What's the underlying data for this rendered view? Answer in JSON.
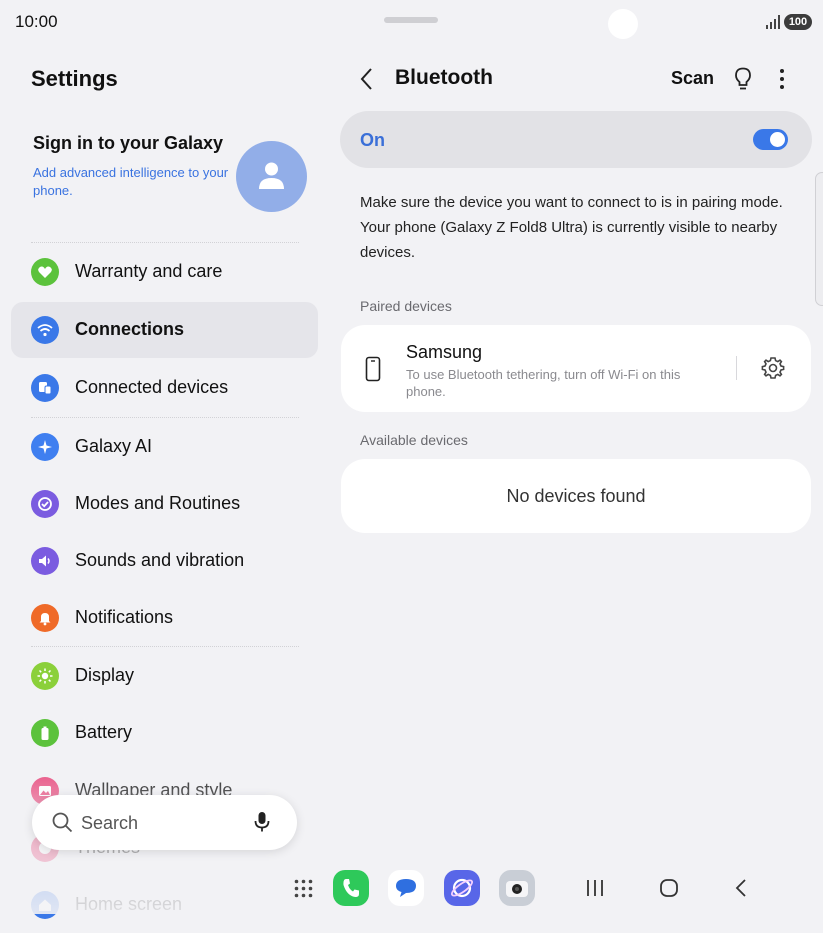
{
  "status": {
    "time": "10:00",
    "battery": "100"
  },
  "left": {
    "title": "Settings",
    "account": {
      "title": "Sign in to your Galaxy",
      "subtitle": "Add advanced intelligence to your phone."
    },
    "items": [
      {
        "label": "Warranty and care",
        "icon": "heart-icon",
        "color": "#5cc23c"
      },
      {
        "label": "Connections",
        "icon": "wifi-icon",
        "color": "#3a78e8",
        "active": true
      },
      {
        "label": "Connected devices",
        "icon": "devices-icon",
        "color": "#3a78e8"
      },
      {
        "label": "Galaxy AI",
        "icon": "sparkle-icon",
        "color": "#3f7ff0"
      },
      {
        "label": "Modes and Routines",
        "icon": "check-circle-icon",
        "color": "#7b5ce0"
      },
      {
        "label": "Sounds and vibration",
        "icon": "speaker-icon",
        "color": "#7b5ce0"
      },
      {
        "label": "Notifications",
        "icon": "bell-icon",
        "color": "#ef6a28"
      },
      {
        "label": "Display",
        "icon": "sun-icon",
        "color": "#8bd03a"
      },
      {
        "label": "Battery",
        "icon": "battery-icon",
        "color": "#5cc23c"
      },
      {
        "label": "Wallpaper and style",
        "icon": "image-icon",
        "color": "#e8467a"
      },
      {
        "label": "Themes",
        "icon": "palette-icon",
        "color": "#e8467a"
      },
      {
        "label": "Home screen",
        "icon": "home-icon",
        "color": "#3a78e8"
      }
    ],
    "search": {
      "placeholder": "Search"
    }
  },
  "right": {
    "title": "Bluetooth",
    "scan_label": "Scan",
    "toggle": {
      "label": "On",
      "state": "on"
    },
    "info": "Make sure the device you want to connect to is in pairing mode. Your phone (Galaxy Z Fold8 Ultra) is currently visible to nearby devices.",
    "paired_title": "Paired devices",
    "paired": [
      {
        "name": "Samsung",
        "subtitle": "To use Bluetooth tethering, turn off Wi-Fi on this phone."
      }
    ],
    "available_title": "Available devices",
    "available_empty": "No devices found"
  },
  "colors": {
    "accent": "#3a78e8",
    "background": "#f2f2f5"
  }
}
